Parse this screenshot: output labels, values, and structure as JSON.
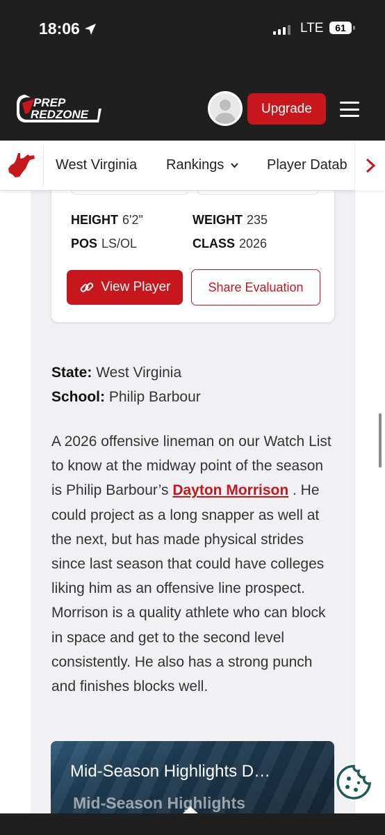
{
  "status": {
    "time": "18:06",
    "network": "LTE",
    "battery": "61"
  },
  "header": {
    "logo_line1": "PREP",
    "logo_line2": "REDZONE",
    "upgrade_label": "Upgrade"
  },
  "state_nav": {
    "items": [
      "West Virginia",
      "Rankings",
      "Player Datab"
    ]
  },
  "player": {
    "height_label": "HEIGHT",
    "height_value": "6'2\"",
    "weight_label": "WEIGHT",
    "weight_value": "235",
    "pos_label": "POS",
    "pos_value": "LS/OL",
    "class_label": "CLASS",
    "class_value": "2026",
    "view_label": "View Player",
    "share_label": "Share Evaluation"
  },
  "meta": {
    "state_label": "State:",
    "state_value": "West Virginia",
    "school_label": "School:",
    "school_value": "Philip Barbour"
  },
  "article": {
    "intro": "A 2026 offensive lineman on our Watch List to know at the midway point of the season is Philip Barbour’s ",
    "player_link": "Dayton Morrison",
    "rest": " . He could project as a long snapper as well at the next, but has made physical strides since last season that could have colleges liking him as an offensive line prospect. Morrison is a quality athlete who can block in space and get to the second level consistently. He also has a strong punch and finishes blocks well."
  },
  "video": {
    "title": "Mid-Season Highlights D…",
    "overlay": "Mid-Season Highlights"
  },
  "colors": {
    "brand_red": "#c8161d",
    "header_bg": "#1f1f1f",
    "content_bg": "#f1f1f4"
  }
}
